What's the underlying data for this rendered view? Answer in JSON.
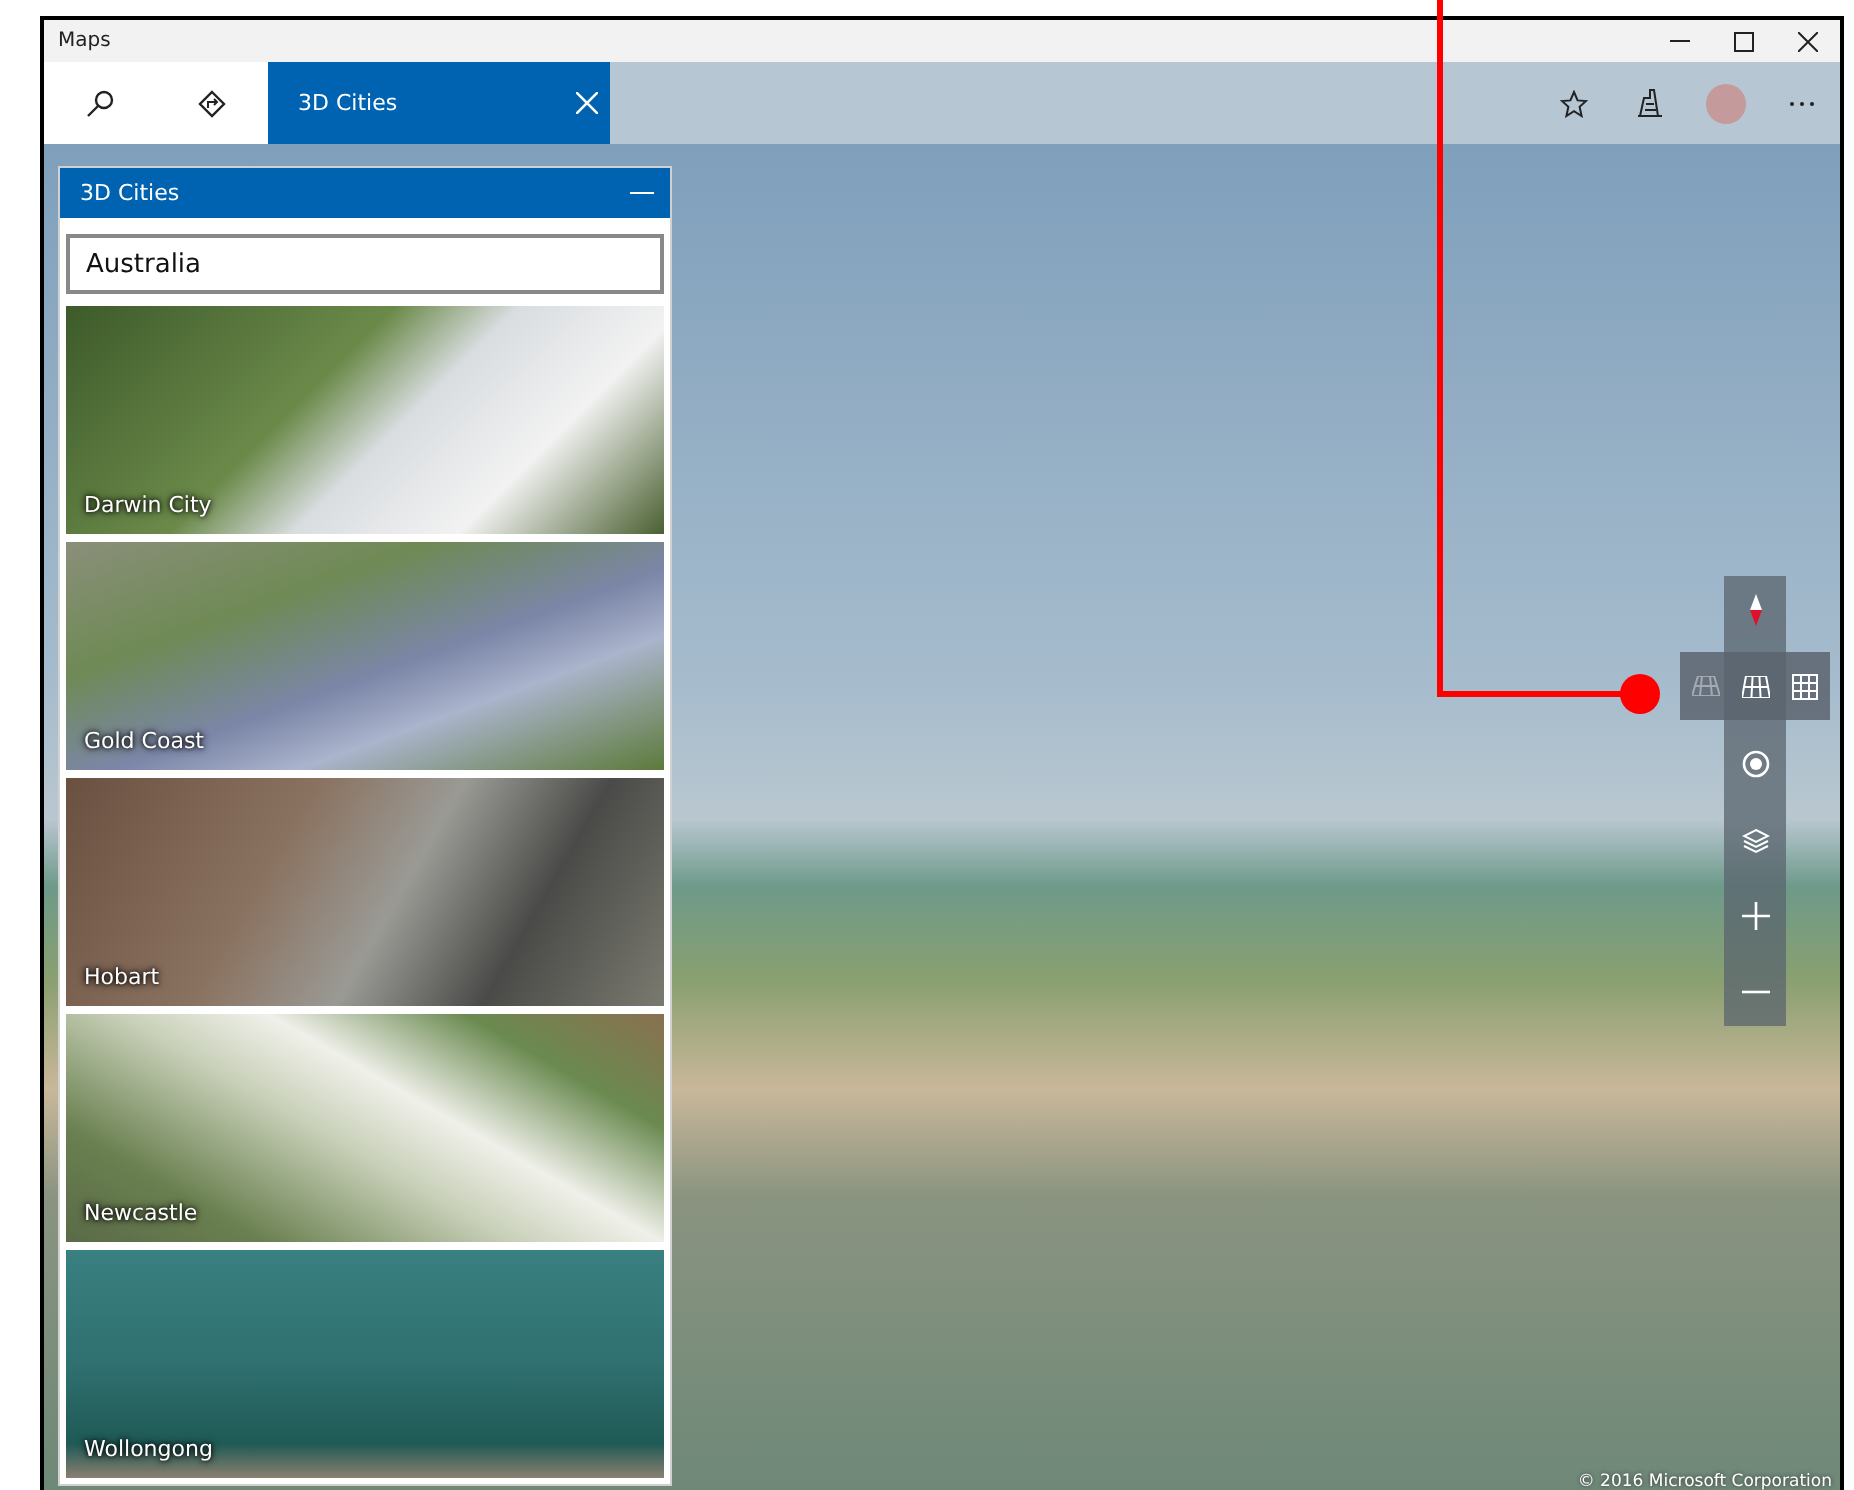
{
  "window": {
    "title": "Maps"
  },
  "toolbar": {
    "tabs": [
      {
        "label": "3D Cities",
        "selected": true
      }
    ]
  },
  "panel": {
    "title": "3D Cities",
    "search": {
      "value": "Australia"
    },
    "cities": [
      {
        "name": "Darwin City"
      },
      {
        "name": "Gold Coast"
      },
      {
        "name": "Hobart"
      },
      {
        "name": "Newcastle"
      },
      {
        "name": "Wollongong"
      }
    ]
  },
  "map": {
    "copyright": "© 2016 Microsoft Corporation"
  }
}
